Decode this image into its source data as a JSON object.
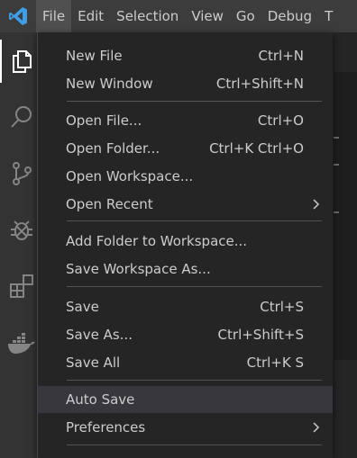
{
  "menubar": {
    "items": [
      {
        "label": "File",
        "active": true
      },
      {
        "label": "Edit"
      },
      {
        "label": "Selection"
      },
      {
        "label": "View"
      },
      {
        "label": "Go"
      },
      {
        "label": "Debug"
      },
      {
        "label": "T"
      }
    ]
  },
  "activity_bar": {
    "icons": [
      "explorer-icon",
      "search-icon",
      "source-control-icon",
      "debug-icon",
      "extensions-icon",
      "docker-icon"
    ]
  },
  "file_menu": {
    "new_file": {
      "label": "New File",
      "shortcut": "Ctrl+N"
    },
    "new_window": {
      "label": "New Window",
      "shortcut": "Ctrl+Shift+N"
    },
    "open_file": {
      "label": "Open File...",
      "shortcut": "Ctrl+O"
    },
    "open_folder": {
      "label": "Open Folder...",
      "shortcut": "Ctrl+K Ctrl+O"
    },
    "open_workspace": {
      "label": "Open Workspace..."
    },
    "open_recent": {
      "label": "Open Recent"
    },
    "add_folder": {
      "label": "Add Folder to Workspace..."
    },
    "save_workspace_as": {
      "label": "Save Workspace As..."
    },
    "save": {
      "label": "Save",
      "shortcut": "Ctrl+S"
    },
    "save_as": {
      "label": "Save As...",
      "shortcut": "Ctrl+Shift+S"
    },
    "save_all": {
      "label": "Save All",
      "shortcut": "Ctrl+K S"
    },
    "auto_save": {
      "label": "Auto Save"
    },
    "preferences": {
      "label": "Preferences"
    }
  },
  "colors": {
    "menubar_bg": "#3c3c3c",
    "activitybar_bg": "#333333",
    "menu_bg": "#252526",
    "menu_highlight": "#37373d",
    "text": "#cccccc",
    "vscode_blue": "#3e9fe8"
  }
}
